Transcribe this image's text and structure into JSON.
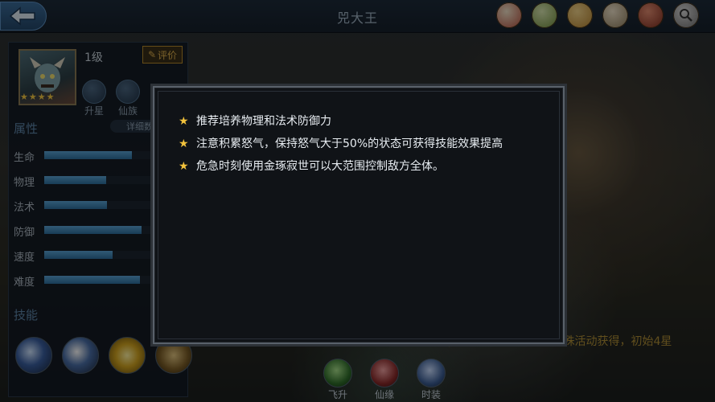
{
  "header": {
    "title": "兕大王"
  },
  "top_icons": [
    "scroll-seal-icon",
    "map-icon",
    "coin-icon",
    "book-icon",
    "scroll-red-icon",
    "search-icon"
  ],
  "hero": {
    "level": "1级",
    "stars": 4,
    "rate_label": "评价",
    "mini_buttons": [
      {
        "label": "升星"
      },
      {
        "label": "仙族"
      }
    ]
  },
  "attributes": {
    "title": "属性",
    "detail_label": "详细数",
    "stats": [
      {
        "label": "生命",
        "value": 0.64
      },
      {
        "label": "物理",
        "value": 0.45
      },
      {
        "label": "法术",
        "value": 0.46
      },
      {
        "label": "防御",
        "value": 0.71
      },
      {
        "label": "速度",
        "value": 0.5
      },
      {
        "label": "难度",
        "value": 0.7
      }
    ]
  },
  "skills": {
    "title": "技能"
  },
  "bg_hint": "；通过北步   仙族类随特殊活动获得，初始4星",
  "bottom_buttons": [
    {
      "label": "飞升"
    },
    {
      "label": "仙缘"
    },
    {
      "label": "时装"
    }
  ],
  "popup": {
    "tips": [
      "推荐培养物理和法术防御力",
      "注意积累怒气，保持怒气大于50%的状态可获得技能效果提高",
      "危急时刻使用金琢寂世可以大范围控制敌方全体。"
    ]
  },
  "colors": {
    "accent": "#f2c23c",
    "bar": "#3f88bd",
    "title": "#9fb2c4"
  }
}
